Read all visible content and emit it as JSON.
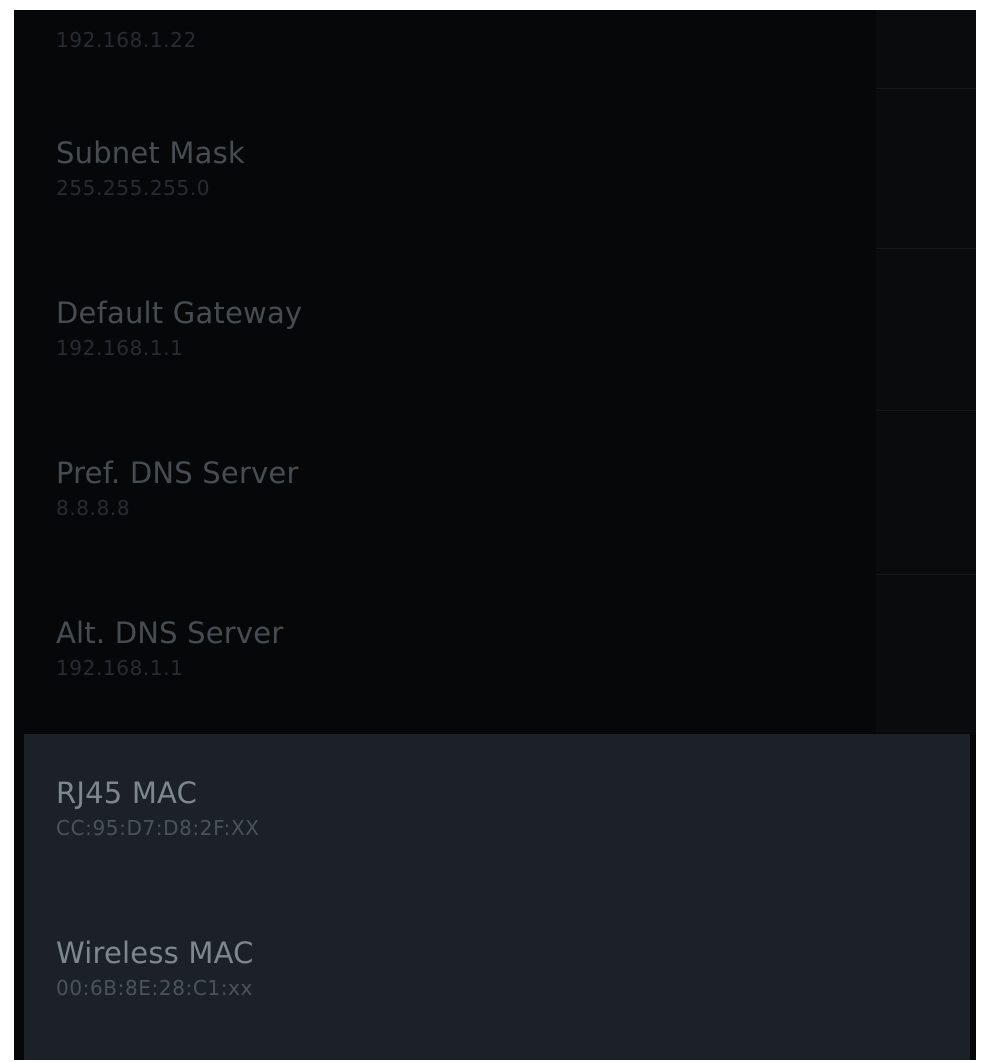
{
  "items": [
    {
      "label": "",
      "value": "192.168.1.22"
    },
    {
      "label": "Subnet Mask",
      "value": "255.255.255.0"
    },
    {
      "label": "Default Gateway",
      "value": "192.168.1.1"
    },
    {
      "label": "Pref. DNS Server",
      "value": "8.8.8.8"
    },
    {
      "label": "Alt. DNS Server",
      "value": "192.168.1.1"
    },
    {
      "label": "RJ45 MAC",
      "value": "CC:95:D7:D8:2F:XX"
    },
    {
      "label": "Wireless MAC",
      "value": "00:6B:8E:28:C1:xx"
    }
  ],
  "colors": {
    "background": "#060708",
    "selected_row": "#1b2127",
    "label_text": "#454c52",
    "selected_label_text": "#7e878f"
  }
}
